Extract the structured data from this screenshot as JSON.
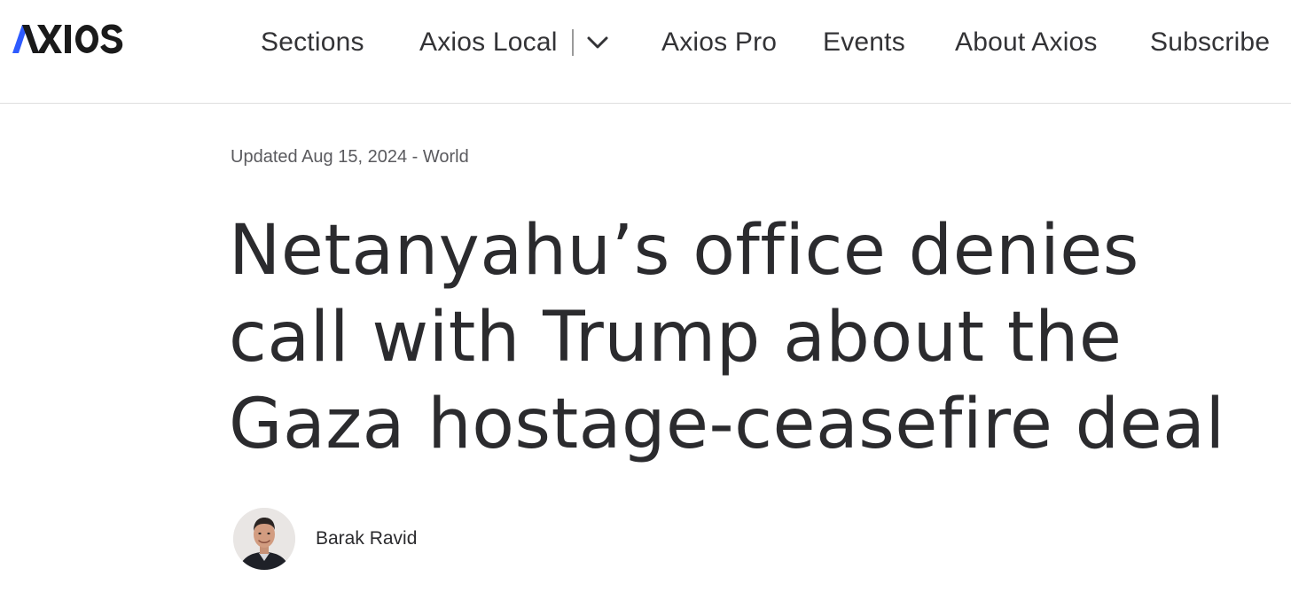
{
  "header": {
    "logo_text": "AXIOS",
    "logo_color": "#1a1a1a",
    "logo_accent": "#2e5bff"
  },
  "nav": {
    "sections": "Sections",
    "axios_local": "Axios Local",
    "axios_pro": "Axios Pro",
    "events": "Events",
    "about": "About Axios",
    "subscribe": "Subscribe",
    "dropdown_icon": "chevron-down-icon"
  },
  "article": {
    "meta": "Updated Aug 15, 2024 - World",
    "headline": "Netanyahu’s office denies call with Trump about the Gaza hostage-ceasefire deal",
    "author": "Barak Ravid",
    "author_avatar_icon": "author-avatar"
  }
}
